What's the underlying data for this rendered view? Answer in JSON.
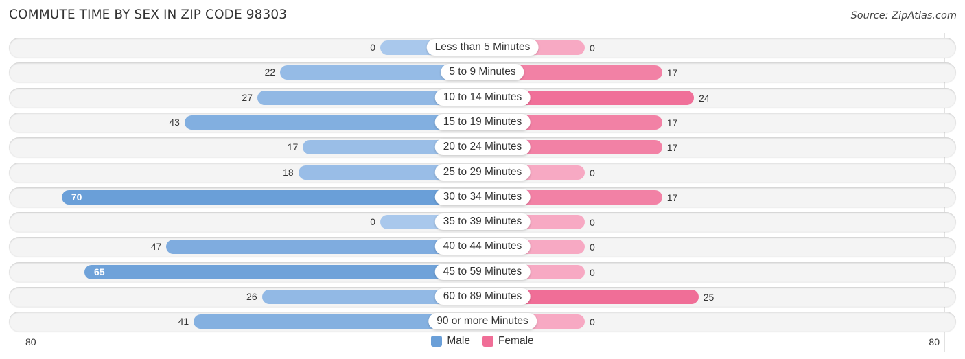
{
  "header": {
    "title": "COMMUTE TIME BY SEX IN ZIP CODE 98303",
    "source": "Source: ZipAtlas.com"
  },
  "colors": {
    "male": "#6a9fd8",
    "male_light": "#a9c8ec",
    "female": "#f06e97",
    "female_light": "#f7a9c3",
    "row_bg": "#f4f4f4"
  },
  "chart_data": {
    "type": "bar",
    "orientation": "horizontal-diverging",
    "title": "COMMUTE TIME BY SEX IN ZIP CODE 98303",
    "categories": [
      "Less than 5 Minutes",
      "5 to 9 Minutes",
      "10 to 14 Minutes",
      "15 to 19 Minutes",
      "20 to 24 Minutes",
      "25 to 29 Minutes",
      "30 to 34 Minutes",
      "35 to 39 Minutes",
      "40 to 44 Minutes",
      "45 to 59 Minutes",
      "60 to 89 Minutes",
      "90 or more Minutes"
    ],
    "series": [
      {
        "name": "Male",
        "values": [
          0,
          22,
          27,
          43,
          17,
          18,
          70,
          0,
          47,
          65,
          26,
          41
        ]
      },
      {
        "name": "Female",
        "values": [
          0,
          17,
          24,
          17,
          17,
          0,
          17,
          0,
          0,
          0,
          25,
          0
        ]
      }
    ],
    "axis": {
      "left_max": 80,
      "right_max": 80,
      "left_tick_label": "80",
      "right_tick_label": "80"
    },
    "legend": {
      "position": "bottom-center",
      "entries": [
        "Male",
        "Female"
      ]
    },
    "grid": false
  }
}
